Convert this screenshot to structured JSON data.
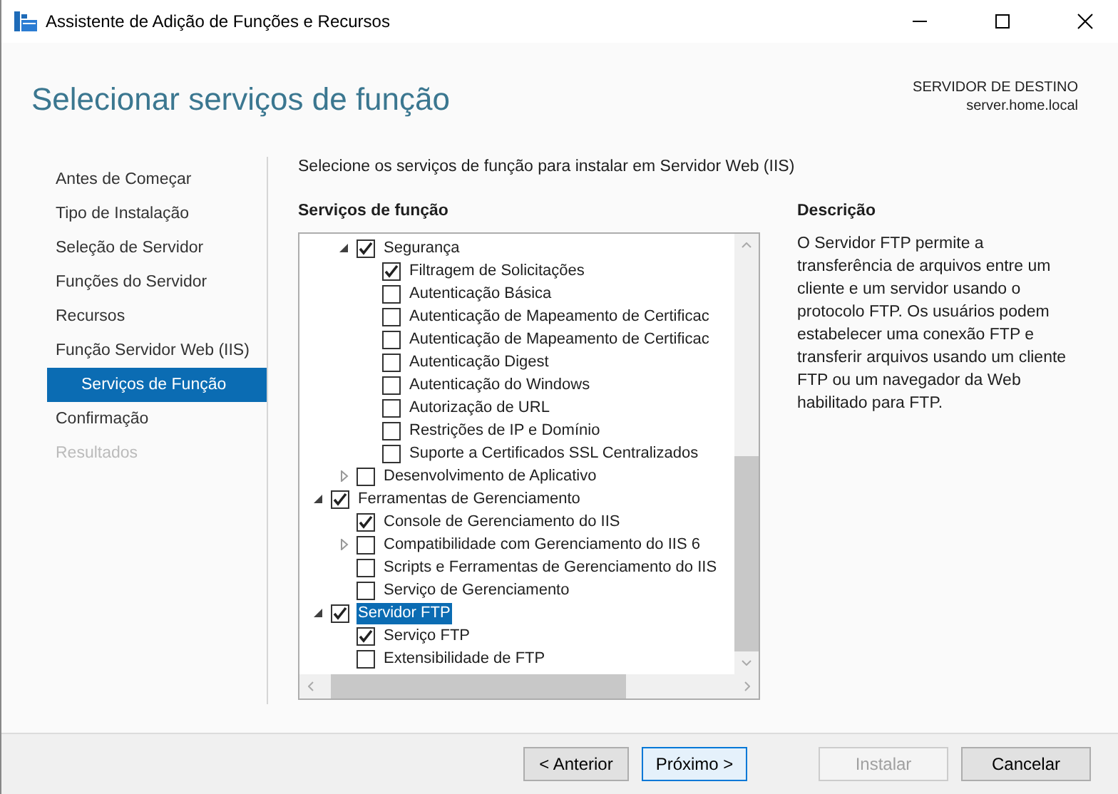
{
  "window": {
    "title": "Assistente de Adição de Funções e Recursos"
  },
  "header": {
    "title": "Selecionar serviços de função",
    "destination_label": "SERVIDOR DE DESTINO",
    "destination_server": "server.home.local"
  },
  "sidebar": {
    "items": [
      {
        "label": "Antes de Começar",
        "selected": false,
        "disabled": false
      },
      {
        "label": "Tipo de Instalação",
        "selected": false,
        "disabled": false
      },
      {
        "label": "Seleção de Servidor",
        "selected": false,
        "disabled": false
      },
      {
        "label": "Funções do Servidor",
        "selected": false,
        "disabled": false
      },
      {
        "label": "Recursos",
        "selected": false,
        "disabled": false
      },
      {
        "label": "Função Servidor Web (IIS)",
        "selected": false,
        "disabled": false,
        "children": [
          {
            "label": "Serviços de Função",
            "selected": true,
            "disabled": false
          }
        ]
      },
      {
        "label": "Confirmação",
        "selected": false,
        "disabled": false
      },
      {
        "label": "Resultados",
        "selected": false,
        "disabled": true
      }
    ]
  },
  "instruction": "Selecione os serviços de função para instalar em Servidor Web (IIS)",
  "tree": {
    "heading": "Serviços de função",
    "continued": [
      {
        "label": "Segurança",
        "checked": true,
        "selected": false,
        "expanded": true,
        "children": [
          {
            "label": "Filtragem de Solicitações",
            "checked": true,
            "selected": false
          },
          {
            "label": "Autenticação Básica",
            "checked": false,
            "selected": false
          },
          {
            "label": "Autenticação de Mapeamento de Certificac",
            "checked": false,
            "selected": false
          },
          {
            "label": "Autenticação de Mapeamento de Certificac",
            "checked": false,
            "selected": false
          },
          {
            "label": "Autenticação Digest",
            "checked": false,
            "selected": false
          },
          {
            "label": "Autenticação do Windows",
            "checked": false,
            "selected": false
          },
          {
            "label": "Autorização de URL",
            "checked": false,
            "selected": false
          },
          {
            "label": "Restrições de IP e Domínio",
            "checked": false,
            "selected": false
          },
          {
            "label": "Suporte a Certificados SSL Centralizados",
            "checked": false,
            "selected": false
          }
        ]
      },
      {
        "label": "Desenvolvimento de Aplicativo",
        "checked": false,
        "selected": false,
        "expanded": false
      }
    ],
    "items": [
      {
        "label": "Ferramentas de Gerenciamento",
        "checked": true,
        "selected": false,
        "expanded": true,
        "children": [
          {
            "label": "Console de Gerenciamento do IIS",
            "checked": true,
            "selected": false
          },
          {
            "label": "Compatibilidade com Gerenciamento do IIS 6",
            "checked": false,
            "selected": false,
            "expanded": false
          },
          {
            "label": "Scripts e Ferramentas de Gerenciamento do IIS",
            "checked": false,
            "selected": false
          },
          {
            "label": "Serviço de Gerenciamento",
            "checked": false,
            "selected": false
          }
        ]
      },
      {
        "label": "Servidor FTP",
        "checked": true,
        "selected": true,
        "expanded": true,
        "children": [
          {
            "label": "Serviço FTP",
            "checked": true,
            "selected": false
          },
          {
            "label": "Extensibilidade de FTP",
            "checked": false,
            "selected": false
          }
        ]
      }
    ]
  },
  "description": {
    "heading": "Descrição",
    "text": "O Servidor FTP permite a transferência de arquivos entre um cliente e um servidor usando o protocolo FTP. Os usuários podem estabelecer uma conexão FTP e transferir arquivos usando um cliente FTP ou um navegador da Web habilitado para FTP."
  },
  "buttons": [
    {
      "label": "< Anterior",
      "default": false,
      "disabled": false
    },
    {
      "label": "Próximo >",
      "default": true,
      "disabled": false
    },
    {
      "label": "Instalar",
      "default": false,
      "disabled": true
    },
    {
      "label": "Cancelar",
      "default": false,
      "disabled": false
    }
  ]
}
